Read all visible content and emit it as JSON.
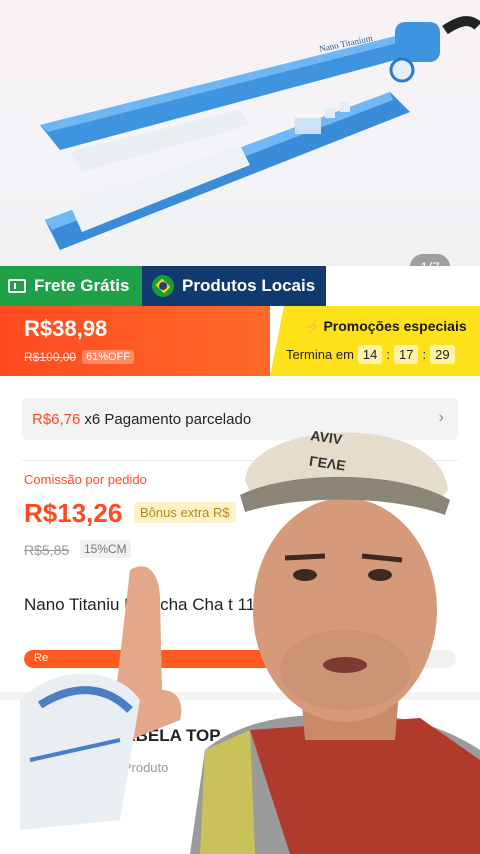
{
  "product_image": {
    "page_indicator": "1/7"
  },
  "badges": {
    "free_shipping": "Frete Grátis",
    "local_products": "Produtos Locais"
  },
  "price_banner": {
    "price": "R$38,98",
    "old_price": "R$100,00",
    "discount": "61%OFF",
    "promo_title": "Promoções especiais",
    "ends_label": "Termina em",
    "timer": {
      "hours": "14",
      "minutes": "17",
      "seconds": "29"
    }
  },
  "installments": {
    "amount": "R$6,76",
    "text": "x6 Pagamento parcelado"
  },
  "commission": {
    "label": "Comissão por pedido",
    "value": "R$13,26",
    "bonus": "Bônus extra R$",
    "old_value": "R$5,85",
    "rate": "15%CM"
  },
  "product": {
    "title": "Nano Titaniu  Prancha Cha                  t 110V/220V",
    "progress_label": "Re",
    "progress_fraction": 0.58
  },
  "shop": {
    "name": "SABELA TOP",
    "subtitle": "6 Produto"
  },
  "colors": {
    "accent_orange": "#ff4a1f",
    "promo_yellow": "#ffe21a",
    "free_shipping_green": "#1fa14a",
    "local_blue": "#103a6e"
  }
}
